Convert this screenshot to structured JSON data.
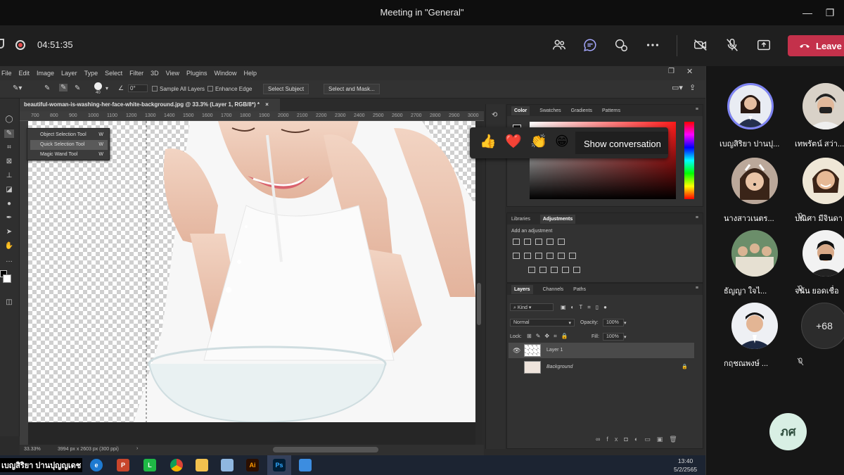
{
  "teams": {
    "title": "Meeting in \"General\"",
    "timer": "04:51:35",
    "leave_label": "Leave",
    "accent_leave": "#c4314b",
    "controls": [
      "people-icon",
      "chat-icon",
      "raise-hand-icon",
      "more-icon",
      "camera-off-icon",
      "mic-off-icon",
      "share-icon"
    ]
  },
  "reactions": {
    "emojis": [
      "👍",
      "❤️",
      "👏",
      "😁"
    ],
    "show_conversation": "Show conversation"
  },
  "photoshop": {
    "menu": [
      "File",
      "Edit",
      "Image",
      "Layer",
      "Type",
      "Select",
      "Filter",
      "3D",
      "View",
      "Plugins",
      "Window",
      "Help"
    ],
    "options": {
      "brush_size": "40",
      "angle": "0°",
      "sample_all_layers": "Sample All Layers",
      "enhance_edge": "Enhance Edge",
      "select_subject": "Select Subject",
      "select_and_mask": "Select and Mask..."
    },
    "doc_tab": "beautiful-woman-is-washing-her-face-white-background.jpg @ 33.3% (Layer 1, RGB/8*) *",
    "ruler": [
      "700",
      "800",
      "900",
      "1000",
      "1100",
      "1200",
      "1300",
      "1400",
      "1500",
      "1600",
      "1700",
      "1800",
      "1900",
      "2000",
      "2100",
      "2200",
      "2300",
      "2400",
      "2500",
      "2600",
      "2700",
      "2800",
      "2900",
      "3000"
    ],
    "flyout": [
      {
        "label": "Object Selection Tool",
        "key": "W"
      },
      {
        "label": "Quick Selection Tool",
        "key": "W"
      },
      {
        "label": "Magic Wand Tool",
        "key": "W"
      }
    ],
    "status": {
      "zoom": "33.33%",
      "doc_info": "3994 px x 2603 px (300 ppi)"
    },
    "color_tabs": [
      "Color",
      "Swatches",
      "Gradients",
      "Patterns"
    ],
    "adj_tabs": [
      "Libraries",
      "Adjustments"
    ],
    "adj_hint": "Add an adjustment",
    "layers_tabs": [
      "Layers",
      "Channels",
      "Paths"
    ],
    "layers": {
      "kind": "Kind",
      "blend": "Normal",
      "opacity_label": "Opacity:",
      "opacity": "100%",
      "lock_label": "Lock:",
      "fill_label": "Fill:",
      "fill": "100%",
      "items": [
        {
          "name": "Layer 1"
        },
        {
          "name": "Background"
        }
      ]
    }
  },
  "taskbar": {
    "user": "เบญสิริยา ปานปุญญเดช",
    "apps": [
      "edge",
      "powerpoint",
      "line",
      "chrome",
      "explorer",
      "notepad",
      "illustrator",
      "photoshop",
      "photos"
    ],
    "app_labels": {
      "ppt": "P",
      "ai": "Ai",
      "ps": "Ps"
    },
    "time": "13:40",
    "date": "5/2/2565"
  },
  "participants": [
    {
      "name": "เบญสิริยา ปานปุ...",
      "active": true
    },
    {
      "name": "เทพรัตน์ สว่า..."
    },
    {
      "name": "นางสาวเนตร..."
    },
    {
      "name": "ปณิศา มีจินดา"
    },
    {
      "name": "ธัญญา ใจไ..."
    },
    {
      "name": "จนัน ยอดเชื่อ"
    },
    {
      "name": "กฤชณพงษ์ ..."
    }
  ],
  "more_count": "+68",
  "self_initials": "ภศ"
}
